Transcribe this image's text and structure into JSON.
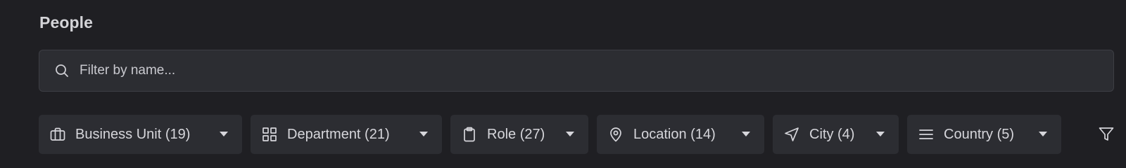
{
  "header": {
    "title": "People"
  },
  "search": {
    "placeholder": "Filter by name...",
    "value": "",
    "icon": "search-icon"
  },
  "filters": [
    {
      "label": "Business Unit (19)",
      "icon": "briefcase-icon"
    },
    {
      "label": "Department (21)",
      "icon": "grid-icon"
    },
    {
      "label": "Role (27)",
      "icon": "clipboard-icon"
    },
    {
      "label": "Location (14)",
      "icon": "map-pin-icon"
    },
    {
      "label": "City (4)",
      "icon": "navigation-icon"
    },
    {
      "label": "Country (5)",
      "icon": "list-icon"
    }
  ],
  "filter_button": {
    "icon": "funnel-icon"
  },
  "colors": {
    "background": "#1f1f23",
    "surface": "#2c2d32",
    "text": "#d6d6db"
  }
}
